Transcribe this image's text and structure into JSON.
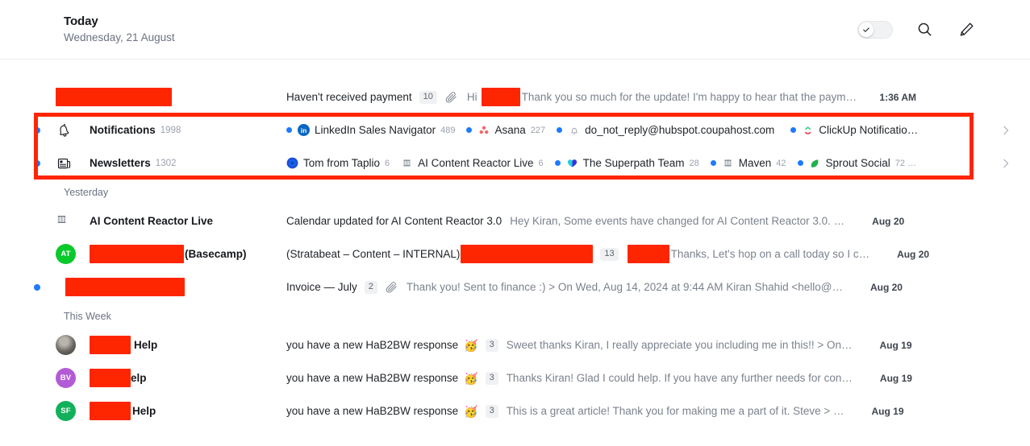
{
  "header": {
    "title": "Today",
    "subtitle": "Wednesday, 21 August",
    "toggle_icon": "check-icon",
    "search_icon": "search-icon",
    "compose_icon": "pencil-icon"
  },
  "sections": [
    {
      "label": ""
    },
    {
      "label": "Yesterday"
    },
    {
      "label": "This Week"
    }
  ],
  "rows": {
    "payment": {
      "sender": "[redacted]",
      "subject": "Haven't received payment",
      "badge": "10",
      "preview_pre": "Hi",
      "preview": "Thank you so much for the update! I'm happy to hear that the paym…",
      "time": "1:36 AM"
    },
    "notifications": {
      "label": "Notifications",
      "count": "1998",
      "icon": "bell-icon",
      "chips": [
        {
          "name": "LinkedIn Sales Navigator",
          "count": "489",
          "icon": "linkedin-icon",
          "unread": true
        },
        {
          "name": "Asana",
          "count": "227",
          "icon": "asana-icon",
          "unread": true
        },
        {
          "name": "do_not_reply@hubspot.coupahost.com",
          "count": "",
          "icon": "bell-outline-icon",
          "unread": true
        },
        {
          "name": "ClickUp Notificatio…",
          "count": "",
          "icon": "clickup-icon",
          "unread": true
        }
      ]
    },
    "newsletters": {
      "label": "Newsletters",
      "count": "1302",
      "icon": "newsletter-icon",
      "chips": [
        {
          "name": "Tom from Taplio",
          "count": "6",
          "icon": "taplio-icon",
          "unread": false
        },
        {
          "name": "AI Content Reactor Live",
          "count": "6",
          "icon": "calendar-icon",
          "unread": false
        },
        {
          "name": "The Superpath Team",
          "count": "28",
          "icon": "superpath-icon",
          "unread": true
        },
        {
          "name": "Maven",
          "count": "42",
          "icon": "calendar-icon",
          "unread": true
        },
        {
          "name": "Sprout Social",
          "count": "72 …",
          "icon": "sprout-icon",
          "unread": true
        }
      ]
    },
    "reactor": {
      "sender": "AI Content Reactor Live",
      "icon": "calendar-icon",
      "subject": "Calendar updated for AI Content Reactor 3.0",
      "preview": "Hey Kiran, Some events have changed for AI Content Reactor 3.0. …",
      "time": "Aug 20"
    },
    "basecamp": {
      "avatar_initials": "AT",
      "avatar_color": "#0ac92b",
      "sender_redacted": "[redacted]",
      "sender_suffix": "(Basecamp)",
      "subject_pre": "(Stratabeat – Content – INTERNAL)",
      "subject_redacted": "[redacted]",
      "badge": "13",
      "preview_redacted": "[redacted]",
      "preview": "Thanks, Let's hop on a call today so I c…",
      "time": "Aug 20"
    },
    "invoice": {
      "sender": "[redacted]",
      "subject": "Invoice — July",
      "badge": "2",
      "preview": "Thank you! Sent to finance :) > On Wed, Aug 14, 2024 at 9:44 AM Kiran Shahid <hello@…",
      "time": "Aug 20"
    },
    "hab2bw": [
      {
        "avatar_initials": "",
        "avatar_color": "photo",
        "sender_redacted": "[redacted]",
        "sender_suffix": "Help",
        "subject": "you have a new HaB2BW response",
        "emoji": "🥳",
        "badge": "3",
        "preview": "Sweet thanks Kiran, I really appreciate you including me in this!! > On…",
        "time": "Aug 19"
      },
      {
        "avatar_initials": "BV",
        "avatar_color": "#b35bd6",
        "sender_redacted": "[redacted]",
        "sender_suffix": "elp",
        "subject": "you have a new HaB2BW response",
        "emoji": "🥳",
        "badge": "3",
        "preview": "Thanks Kiran! Glad I could help. If you have any further needs for con…",
        "time": "Aug 19"
      },
      {
        "avatar_initials": "SF",
        "avatar_color": "#12b05a",
        "sender_redacted": "[redacted]",
        "sender_suffix": "Help",
        "subject": "you have a new HaB2BW response",
        "emoji": "🥳",
        "badge": "3",
        "preview": "This is a great article! Thank you for making me a part of it. Steve > …",
        "time": "Aug 19"
      }
    ]
  },
  "colors": {
    "accent": "#1d7afc",
    "redaction": "#fe2600",
    "highlight": "#fe2600"
  }
}
